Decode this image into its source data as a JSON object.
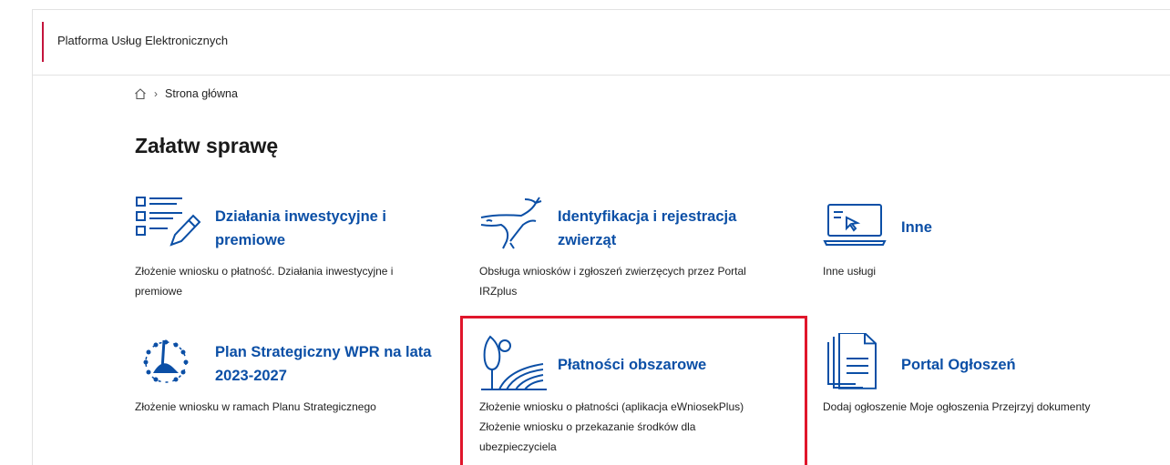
{
  "header": {
    "title": "Platforma Usług Elektronicznych"
  },
  "breadcrumb": {
    "current": "Strona główna"
  },
  "page": {
    "heading": "Załatw sprawę"
  },
  "tiles": [
    {
      "name": "Działania inwestycyjne i premiowe",
      "line1": "Działania inwestycyjne i",
      "line2": "premiowe",
      "desc1": "Złożenie wniosku o płatność. Działania inwestycyjne i",
      "desc2": "premiowe",
      "icon": "checklist-pen-icon"
    },
    {
      "name": "Identyfikacja i rejestracja zwierząt",
      "line1": "Identyfikacja i rejestracja",
      "line2": "zwierząt",
      "desc1": "Obsługa wniosków i zgłoszeń zwierzęcych przez Portal",
      "desc2": "IRZplus",
      "icon": "cow-icon"
    },
    {
      "name": "Inne",
      "line1": "Inne",
      "desc1": "Inne usługi",
      "icon": "laptop-cursor-icon"
    },
    {
      "name": "Plan Strategiczny WPR na lata 2023-2027",
      "line1": "Plan Strategiczny WPR na lata",
      "line2": "2023-2027",
      "desc1": "Złożenie wniosku w ramach Planu Strategicznego",
      "icon": "eu-plan-icon"
    },
    {
      "name": "Płatności obszarowe",
      "line1": "Płatności obszarowe",
      "desc1": "Złożenie wniosku o płatności (aplikacja eWniosekPlus)",
      "desc2": "Złożenie wniosku o przekazanie środków dla",
      "desc3": "ubezpieczyciela",
      "icon": "field-tree-icon"
    },
    {
      "name": "Portal Ogłoszeń",
      "line1": "Portal Ogłoszeń",
      "desc1": "Dodaj ogłoszenie Moje ogłoszenia Przejrzyj dokumenty",
      "icon": "documents-icon"
    }
  ],
  "colors": {
    "brand": "#0b4fa6",
    "accent": "#c4143c",
    "highlight": "#e0162b"
  }
}
